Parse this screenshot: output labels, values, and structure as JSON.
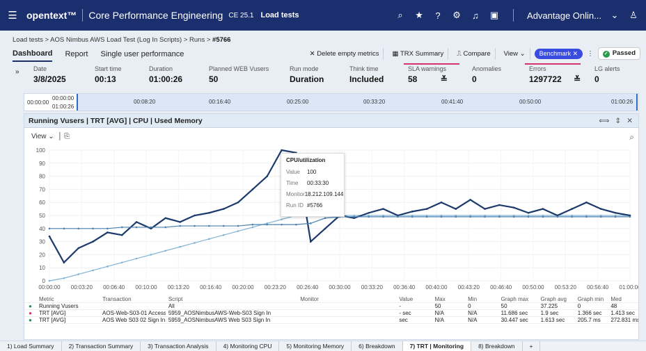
{
  "header": {
    "brand": "opentext™",
    "product": "Core Performance Engineering",
    "version": "CE 25.1",
    "section": "Load tests",
    "tenant": "Advantage Onlin..."
  },
  "breadcrumb": {
    "root": "Load tests",
    "test": "AOS Nimbus AWS Load Test (Log In Scripts)",
    "runs": "Runs",
    "current": "#5766"
  },
  "tabs": [
    "Dashboard",
    "Report",
    "Single user performance"
  ],
  "toolbar": {
    "delete": "Delete empty metrics",
    "trx": "TRX Summary",
    "compare": "Compare",
    "view": "View",
    "benchmark": "Benchmark",
    "status": "Passed"
  },
  "stats": [
    {
      "label": "Date",
      "value": "3/8/2025"
    },
    {
      "label": "Start time",
      "value": "00:13"
    },
    {
      "label": "Duration",
      "value": "01:00:26"
    },
    {
      "label": "Planned WEB Vusers",
      "value": "50"
    },
    {
      "label": "Run mode",
      "value": "Duration"
    },
    {
      "label": "Think time",
      "value": "Included"
    },
    {
      "label": "SLA warnings",
      "value": "58"
    },
    {
      "label": "Anomalies",
      "value": "0"
    },
    {
      "label": "Errors",
      "value": "1297722"
    },
    {
      "label": "LG alerts",
      "value": "0"
    }
  ],
  "timeline": {
    "start_top": "00:00:00",
    "start_bottom": "01:00:26",
    "left": "00:00:00",
    "ticks": [
      "00:08:20",
      "00:16:40",
      "00:25:00",
      "00:33:20",
      "00:41:40",
      "00:50:00",
      "01:00:26"
    ]
  },
  "panel": {
    "title": "Running Vusers | TRT [AVG] | CPU | Used Memory",
    "view": "View"
  },
  "tooltip": {
    "title": "CPU/utilization",
    "value_label": "Value",
    "value": "100",
    "time_label": "Time",
    "time": "00:33:30",
    "monitor_label": "Monitor",
    "monitor": "18.212.109.144",
    "run_label": "Run ID",
    "run": "#5766"
  },
  "chart_data": {
    "type": "line",
    "ylim": [
      0,
      100
    ],
    "yticks": [
      "0",
      "10",
      "20",
      "30",
      "40",
      "50",
      "60",
      "70",
      "80",
      "90",
      "100"
    ],
    "xticks": [
      "00:00:00",
      "00:03:20",
      "00:06:40",
      "00:10:00",
      "00:13:20",
      "00:16:40",
      "00:20:00",
      "00:23:20",
      "00:26:40",
      "00:30:00",
      "00:33:20",
      "00:36:40",
      "00:40:00",
      "00:43:20",
      "00:46:40",
      "00:50:00",
      "00:53:20",
      "00:56:40",
      "01:00:00"
    ],
    "series": [
      {
        "name": "Running Vusers",
        "color": "#7fb3d5",
        "values": [
          0,
          2,
          5,
          8,
          11,
          14,
          17,
          20,
          23,
          26,
          29,
          32,
          35,
          38,
          41,
          44,
          47,
          50,
          50,
          50,
          50,
          50,
          50,
          50,
          50,
          50,
          50,
          50,
          50,
          50,
          50,
          50,
          50,
          50,
          50,
          50,
          50,
          50,
          50,
          50,
          50
        ]
      },
      {
        "name": "CPU",
        "color": "#1b3a6b",
        "values": [
          34,
          14,
          25,
          30,
          37,
          35,
          45,
          40,
          48,
          45,
          50,
          52,
          55,
          60,
          70,
          80,
          100,
          98,
          30,
          40,
          50,
          48,
          52,
          55,
          50,
          53,
          55,
          60,
          55,
          62,
          55,
          58,
          56,
          52,
          55,
          50,
          55,
          60,
          55,
          52,
          50
        ]
      },
      {
        "name": "Used Memory",
        "color": "#4a7fb0",
        "values": [
          40,
          40,
          40,
          40,
          40,
          41,
          41,
          41,
          41,
          42,
          42,
          42,
          42,
          42,
          43,
          43,
          43,
          43,
          44,
          48,
          49,
          49,
          49,
          49,
          49,
          49,
          49,
          49,
          49,
          49,
          49,
          49,
          49,
          49,
          49,
          49,
          49,
          49,
          49,
          49,
          49
        ]
      }
    ]
  },
  "grid": {
    "headers": [
      "Metric",
      "Transaction",
      "Script",
      "Monitor",
      "Value",
      "Max",
      "Min",
      "Graph max",
      "Graph avg",
      "Graph min",
      "Med"
    ],
    "rows": [
      {
        "color": "#2b8a5a",
        "cells": [
          "Running Vusers",
          "",
          "All",
          "",
          "-",
          "50",
          "0",
          "50",
          "37.225",
          "0",
          "48"
        ]
      },
      {
        "color": "#d6336c",
        "cells": [
          "TRT [AVG]",
          "AOS-Web-S03-01 Access AO...",
          "5959_AOSNimbusAWS-Web-S03 Sign In",
          "",
          "- sec",
          "N/A",
          "N/A",
          "11.686 sec",
          "1.9 sec",
          "1.366 sec",
          "1.413 sec"
        ]
      },
      {
        "color": "#2b8a5a",
        "cells": [
          "TRT [AVG]",
          "AOS Web S03 02 Sign In",
          "5959_AOSNimbusAWS Web S03 Sign In",
          "",
          "sec",
          "N/A",
          "N/A",
          "30.447 sec",
          "1.613 sec",
          "205.7 ms",
          "272.831 ms"
        ]
      }
    ]
  },
  "bottom_tabs": [
    "1) Load Summary",
    "2) Transaction Summary",
    "3) Transaction Analysis",
    "4) Monitoring CPU",
    "5) Monitoring Memory",
    "6) Breakdown",
    "7) TRT | Monitoring",
    "8) Breakdown"
  ]
}
